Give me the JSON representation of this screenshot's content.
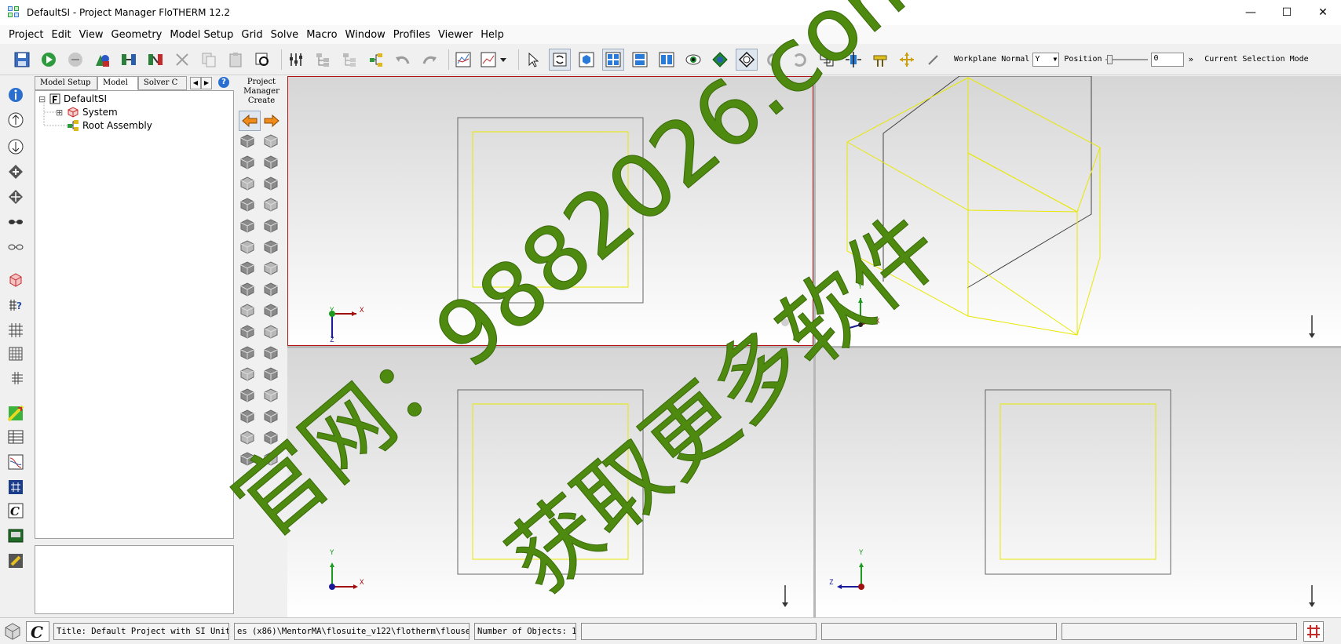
{
  "window": {
    "title": "DefaultSI - Project Manager FloTHERM 12.2",
    "minimize": "—",
    "maximize": "☐",
    "close": "✕"
  },
  "menu": [
    "Project",
    "Edit",
    "View",
    "Geometry",
    "Model Setup",
    "Grid",
    "Solve",
    "Macro",
    "Window",
    "Profiles",
    "Viewer",
    "Help"
  ],
  "toolbar": {
    "workplane_label": "Workplane Normal",
    "workplane_value": "Y",
    "position_label": "Position",
    "position_value": "0",
    "selection_mode_label": "Current Selection Mode"
  },
  "tree_panel": {
    "tabs": [
      "Model Setup",
      "Model",
      "Solver C"
    ],
    "active_tab": "Model",
    "nodes": [
      {
        "label": "DefaultSI",
        "expander": "⊟"
      },
      {
        "label": "System",
        "expander": "⊞"
      },
      {
        "label": "Root Assembly",
        "expander": ""
      }
    ]
  },
  "palette": {
    "title_line1": "Project",
    "title_line2": "Manager",
    "title_line3": "Create"
  },
  "viewports": {
    "top_left": {
      "axis_v": "Y",
      "axis_h": "X",
      "axis_d": "Z"
    },
    "top_right": {
      "axis_v": "Y",
      "axis_h": "X"
    },
    "bottom_left": {
      "axis_v": "Y",
      "axis_h": "X"
    },
    "bottom_right": {
      "axis_v": "Y",
      "axis_h": "Z"
    }
  },
  "statusbar": {
    "title": "Title: Default Project with SI Units",
    "path": "es (x86)\\MentorMA\\flosuite_v122\\flotherm\\flouser\\",
    "objects": "Number of Objects: 1"
  },
  "watermark": {
    "line1": "官网：9882026.com",
    "line2": "获取更多软件"
  },
  "colors": {
    "accent_green": "#4d8a0f",
    "yellow_box": "#e8e800",
    "axis_red": "#a01010",
    "axis_green": "#1c9b1c",
    "axis_blue": "#1a1a9a",
    "active_border": "#b01414"
  }
}
